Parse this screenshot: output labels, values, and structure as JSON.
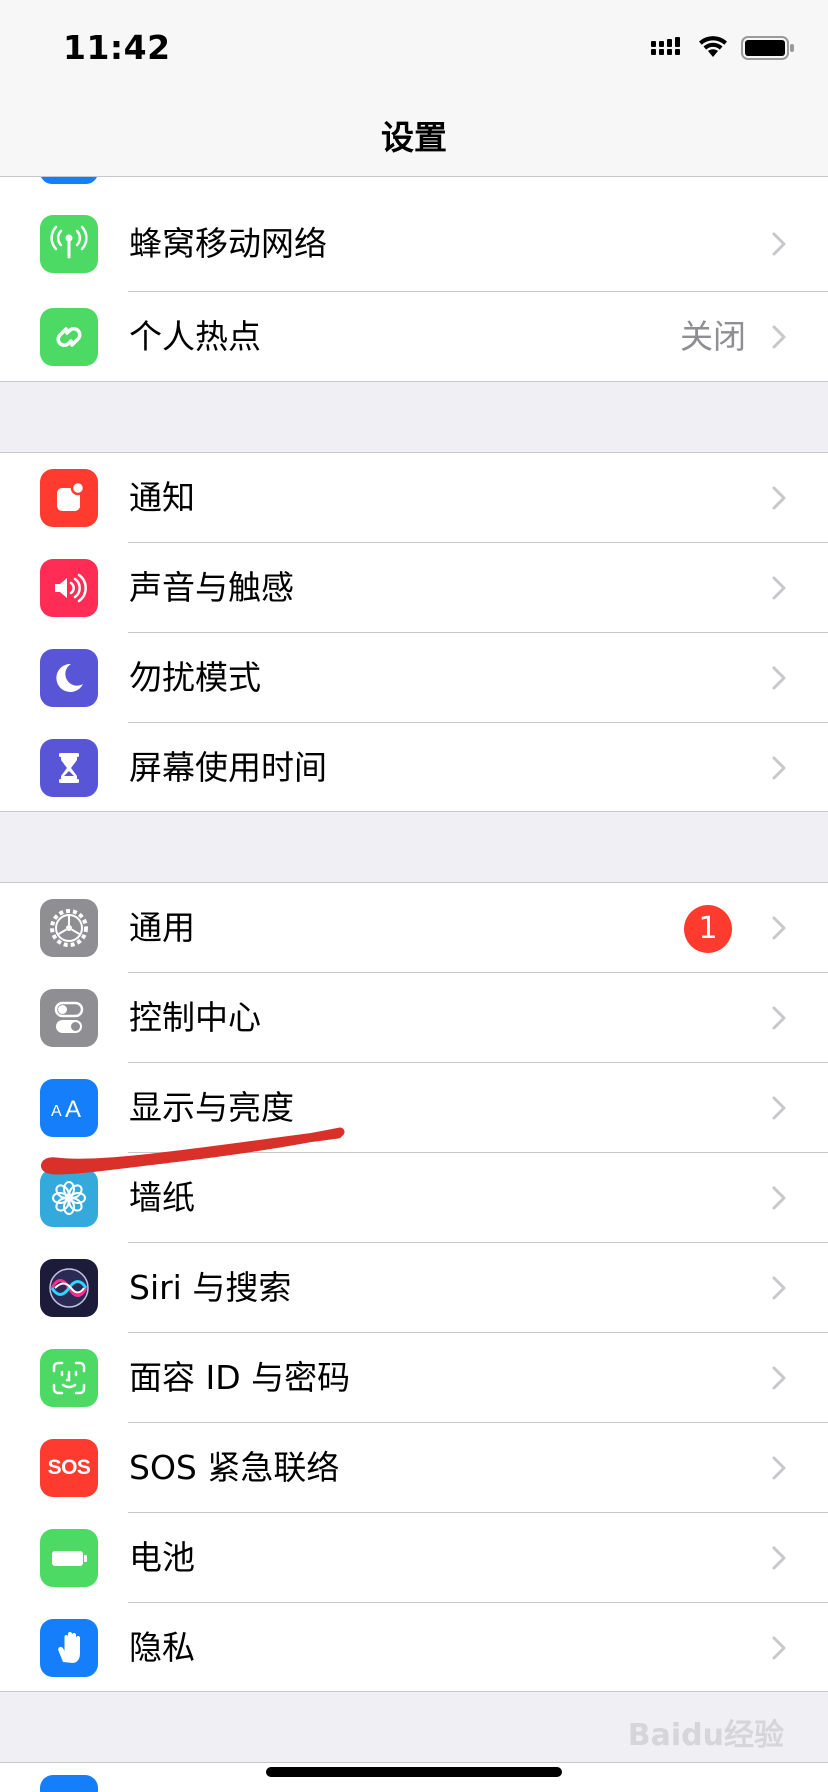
{
  "status_bar": {
    "time": "11:42",
    "signal_icon": "cellular-signal-icon",
    "wifi_icon": "wifi-icon",
    "battery_icon": "battery-icon"
  },
  "header": {
    "title": "设置"
  },
  "groups": [
    {
      "id": "network",
      "rows": [
        {
          "label": "蜂窝移动网络",
          "icon": "cellular-antenna-icon",
          "icon_color": "#4cd964",
          "value": "",
          "badge": ""
        },
        {
          "label": "个人热点",
          "icon": "hotspot-link-icon",
          "icon_color": "#4cd964",
          "value": "关闭",
          "badge": ""
        }
      ]
    },
    {
      "id": "alerts",
      "rows": [
        {
          "label": "通知",
          "icon": "notifications-icon",
          "icon_color": "#ff3b30",
          "value": "",
          "badge": ""
        },
        {
          "label": "声音与触感",
          "icon": "speaker-icon",
          "icon_color": "#ff2d55",
          "value": "",
          "badge": ""
        },
        {
          "label": "勿扰模式",
          "icon": "moon-icon",
          "icon_color": "#5856d6",
          "value": "",
          "badge": ""
        },
        {
          "label": "屏幕使用时间",
          "icon": "hourglass-icon",
          "icon_color": "#5856d6",
          "value": "",
          "badge": ""
        }
      ]
    },
    {
      "id": "general",
      "rows": [
        {
          "label": "通用",
          "icon": "gear-icon",
          "icon_color": "#8e8e93",
          "value": "",
          "badge": "1"
        },
        {
          "label": "控制中心",
          "icon": "toggles-icon",
          "icon_color": "#8e8e93",
          "value": "",
          "badge": ""
        },
        {
          "label": "显示与亮度",
          "icon": "text-size-icon",
          "icon_color": "#147efb",
          "value": "",
          "badge": ""
        },
        {
          "label": "墙纸",
          "icon": "flower-icon",
          "icon_color": "#34aadc",
          "value": "",
          "badge": ""
        },
        {
          "label": "Siri 与搜索",
          "icon": "siri-icon",
          "icon_color": "#1c1c3a",
          "value": "",
          "badge": ""
        },
        {
          "label": "面容 ID 与密码",
          "icon": "face-id-icon",
          "icon_color": "#4cd964",
          "value": "",
          "badge": ""
        },
        {
          "label": "SOS 紧急联络",
          "icon": "sos-icon",
          "icon_color": "#ff3b30",
          "value": "",
          "badge": "",
          "icon_text": "SOS"
        },
        {
          "label": "电池",
          "icon": "battery-setting-icon",
          "icon_color": "#4cd964",
          "value": "",
          "badge": ""
        },
        {
          "label": "隐私",
          "icon": "hand-icon",
          "icon_color": "#147efb",
          "value": "",
          "badge": ""
        }
      ]
    }
  ],
  "annotation": {
    "color": "#d9302a"
  },
  "watermark": {
    "text": "Baidu经验"
  }
}
